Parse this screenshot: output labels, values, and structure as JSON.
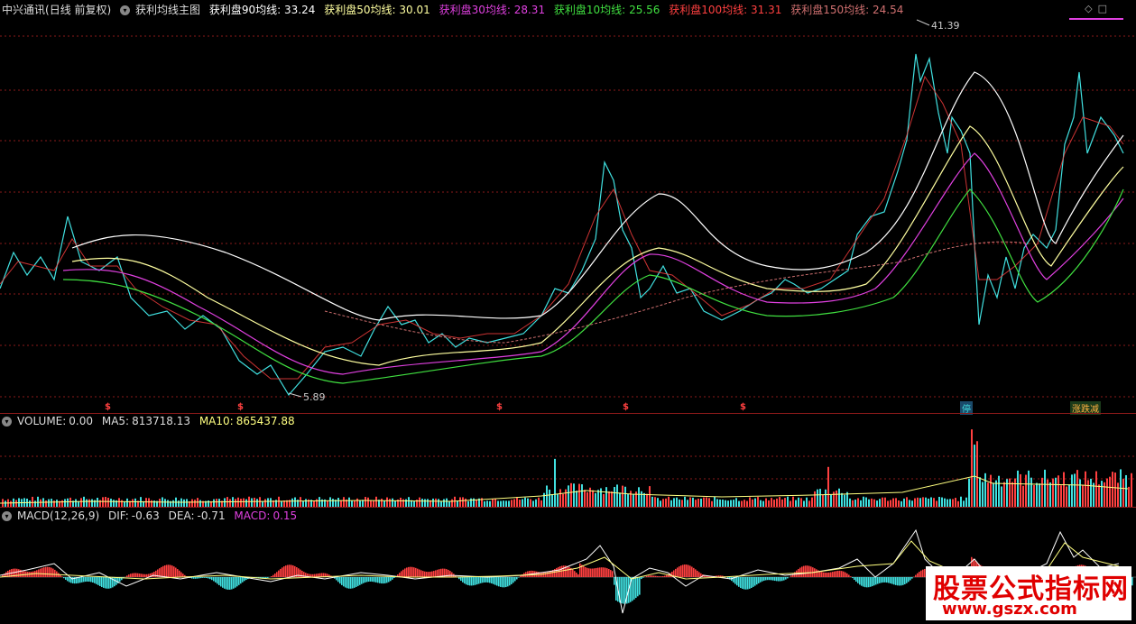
{
  "main": {
    "stock_name": "中兴通讯",
    "period": "(日线 前复权)",
    "indicator_title": "获利均线主图",
    "ma_labels": [
      {
        "label": "获利盘90均线:",
        "value": "33.24",
        "color": "#ffffff"
      },
      {
        "label": "获利盘50均线:",
        "value": "30.01",
        "color": "#ffffa0"
      },
      {
        "label": "获利盘30均线:",
        "value": "28.31",
        "color": "#e040e0"
      },
      {
        "label": "获利盘10均线:",
        "value": "25.56",
        "color": "#40e040"
      },
      {
        "label": "获利盘100均线:",
        "value": "31.31",
        "color": "#ff4040"
      },
      {
        "label": "获利盘150均线:",
        "value": "24.54",
        "color": "#d07070"
      }
    ],
    "high_label": "41.39",
    "low_label": "5.89",
    "signal_mark": "$",
    "tag_ting": "停",
    "tag_zd": "涨跌减"
  },
  "volume": {
    "label": "VOLUME:",
    "value": "0.00",
    "ma5_label": "MA5:",
    "ma5": "813718.13",
    "ma10_label": "MA10:",
    "ma10": "865437.88"
  },
  "macd": {
    "label": "MACD(12,26,9)",
    "dif_label": "DIF:",
    "dif": "-0.63",
    "dea_label": "DEA:",
    "dea": "-0.71",
    "macd_label": "MACD:",
    "macd": "0.15"
  },
  "watermark": {
    "title": "股票公式指标网",
    "url": "www.gszx.com"
  },
  "colors": {
    "up": "#ff4040",
    "down": "#40e0e0",
    "grid": "#8a1a1a",
    "bg": "#000000"
  },
  "icons": [
    "chevron-down-icon",
    "diamond-icon",
    "window-icon"
  ]
}
